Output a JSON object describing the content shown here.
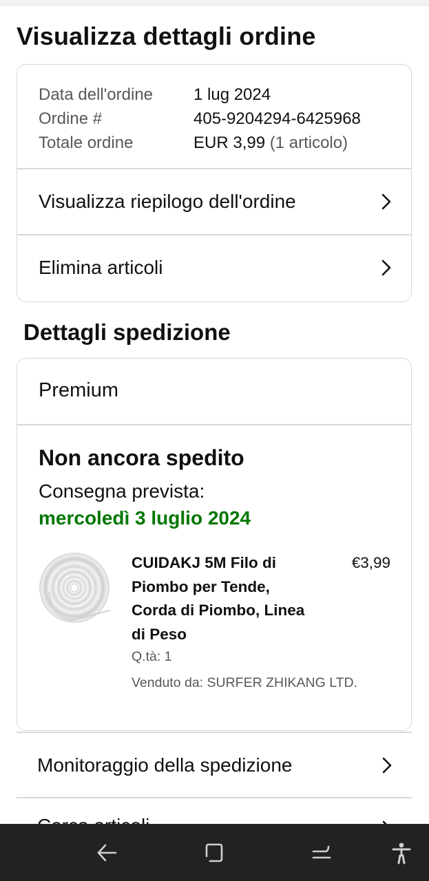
{
  "page": {
    "title": "Visualizza dettagli ordine"
  },
  "order_info": {
    "date_label": "Data dell'ordine",
    "date_value": "1 lug 2024",
    "number_label": "Ordine #",
    "number_value": "405-9204294-6425968",
    "total_label": "Totale ordine",
    "total_value": "EUR 3,99",
    "total_items": "(1 articolo)"
  },
  "order_actions": {
    "summary_label": "Visualizza riepilogo dell'ordine",
    "delete_label": "Elimina articoli"
  },
  "shipping": {
    "section_title": "Dettagli spedizione",
    "service": "Premium",
    "status": "Non ancora spedito",
    "delivery_label": "Consegna prevista:",
    "delivery_date": "mercoledì 3 luglio 2024",
    "item": {
      "name": "CUIDAKJ 5M Filo di Piombo per Tende, Corda di Piombo, Linea di Peso",
      "price": "€3,99",
      "quantity": "Q.tà: 1",
      "seller": "Venduto da: SURFER ZHIKANG LTD."
    }
  },
  "tracking": {
    "label": "Monitoraggio della spedizione"
  },
  "next_row_partial": {
    "label": "Cerca articoli"
  },
  "colors": {
    "delivery_green": "#007600",
    "border": "#d5d9d9",
    "muted_text": "#565959",
    "navbar_bg": "#222222"
  },
  "icons": {
    "chevron": "chevron-right-icon",
    "nav_back": "back-arrow-icon",
    "nav_home": "home-square-icon",
    "nav_recents": "recents-icon",
    "nav_accessibility": "accessibility-icon"
  }
}
